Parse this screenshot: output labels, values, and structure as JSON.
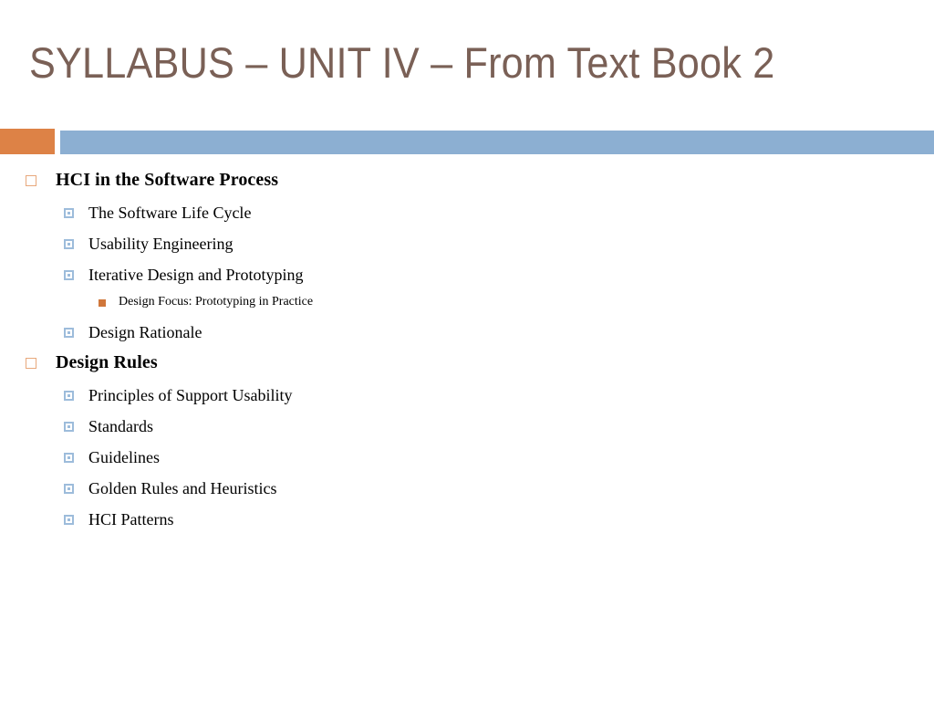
{
  "slide": {
    "title": "SYLLABUS – UNIT IV – From Text Book 2",
    "colors": {
      "title_text": "#7A6056",
      "bar_orange": "#DD8246",
      "bar_blue": "#8CAFD2",
      "bullet_level1": "#E8A87C",
      "bullet_level2": "#9DBCDB",
      "bullet_level3": "#D0773B",
      "body_text": "#000000",
      "background": "#FFFFFF"
    },
    "outline": [
      {
        "level": 1,
        "text": "HCI in the Software Process",
        "bullet": "hollow-orange-square-bullet"
      },
      {
        "level": 2,
        "text": "The Software Life Cycle",
        "bullet": "blue-square-bullet"
      },
      {
        "level": 2,
        "text": "Usability Engineering",
        "bullet": "blue-square-bullet"
      },
      {
        "level": 2,
        "text": "Iterative Design and Prototyping",
        "bullet": "blue-square-bullet"
      },
      {
        "level": 3,
        "text": "Design Focus: Prototyping in Practice",
        "bullet": "solid-orange-square-bullet"
      },
      {
        "level": 2,
        "text": "Design Rationale",
        "bullet": "blue-square-bullet"
      },
      {
        "level": 1,
        "text": "Design Rules",
        "bullet": "hollow-orange-square-bullet"
      },
      {
        "level": 2,
        "text": "Principles of Support Usability",
        "bullet": "blue-square-bullet"
      },
      {
        "level": 2,
        "text": "Standards",
        "bullet": "blue-square-bullet"
      },
      {
        "level": 2,
        "text": "Guidelines",
        "bullet": "blue-square-bullet"
      },
      {
        "level": 2,
        "text": "Golden Rules and Heuristics",
        "bullet": "blue-square-bullet"
      },
      {
        "level": 2,
        "text": "HCI Patterns",
        "bullet": "blue-square-bullet"
      }
    ]
  }
}
